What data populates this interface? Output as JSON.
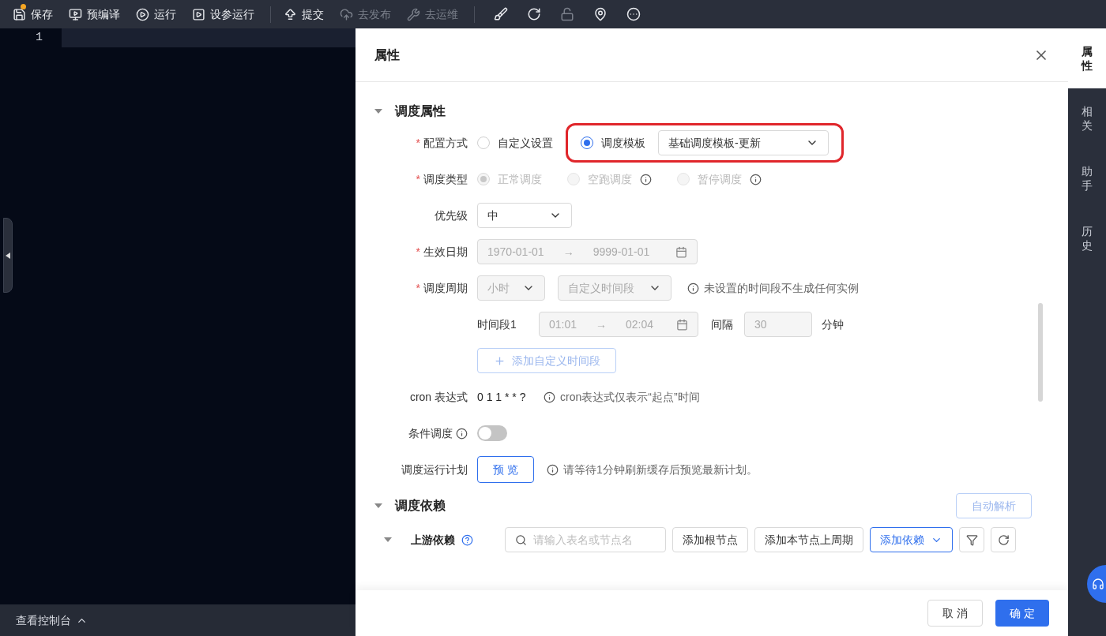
{
  "toolbar": {
    "groups": [
      [
        {
          "label": "保存",
          "disabled": false,
          "modified": true
        },
        {
          "label": "预编译",
          "disabled": false,
          "modified": false
        },
        {
          "label": "运行",
          "disabled": false,
          "modified": false
        },
        {
          "label": "设参运行",
          "disabled": false,
          "modified": false
        }
      ],
      [
        {
          "label": "提交",
          "disabled": false,
          "modified": false
        },
        {
          "label": "去发布",
          "disabled": true,
          "modified": false
        },
        {
          "label": "去运维",
          "disabled": true,
          "modified": false
        }
      ]
    ],
    "icon_buttons": [
      {
        "disabled": false
      },
      {
        "disabled": false
      },
      {
        "disabled": true
      },
      {
        "disabled": false
      },
      {
        "disabled": false
      }
    ]
  },
  "editor": {
    "line_numbers": [
      "1"
    ]
  },
  "console": {
    "label": "查看控制台",
    "expanded": false
  },
  "panel": {
    "title": "属性",
    "schedule": {
      "title": "调度属性",
      "expanded": true,
      "config_mode": {
        "label": "配置方式",
        "required_mark": "*",
        "options": [
          {
            "label": "自定义设置",
            "selected": false
          },
          {
            "label": "调度模板",
            "selected": true
          }
        ],
        "template": "基础调度模板-更新",
        "highlighted": true
      },
      "schedule_type": {
        "label": "调度类型",
        "required_mark": "*",
        "disabled": true,
        "options": [
          {
            "label": "正常调度",
            "selected": true,
            "info": false
          },
          {
            "label": "空跑调度",
            "selected": false,
            "info": true
          },
          {
            "label": "暂停调度",
            "selected": false,
            "info": true
          }
        ]
      },
      "priority": {
        "label": "优先级",
        "value": "中"
      },
      "effective_date": {
        "label": "生效日期",
        "required_mark": "*",
        "start": "1970-01-01",
        "separator": "→",
        "end": "9999-01-01"
      },
      "cycle": {
        "label": "调度周期",
        "required_mark": "*",
        "unit": "小时",
        "mode": "自定义时间段",
        "hint": "未设置的时间段不生成任何实例"
      },
      "periods": [
        {
          "label": "时间段1",
          "start": "01:01",
          "separator": "→",
          "end": "02:04",
          "interval_label": "间隔",
          "interval": "30",
          "unit": "分钟"
        }
      ],
      "add_period": "添加自定义时间段",
      "cron": {
        "label": "cron 表达式",
        "value": "0 1 1 * * ?",
        "hint": "cron表达式仅表示“起点”时间"
      },
      "condition": {
        "label": "条件调度",
        "on": false
      },
      "plan": {
        "label": "调度运行计划",
        "button": "预 览",
        "hint": "请等待1分钟刷新缓存后预览最新计划。"
      }
    },
    "dependencies": {
      "title": "调度依赖",
      "expanded": true,
      "auto_parse": "自动解析",
      "upstream": {
        "label": "上游依赖",
        "expanded": true,
        "search_placeholder": "请输入表名或节点名",
        "buttons": [
          "添加根节点",
          "添加本节点上周期"
        ],
        "add": "添加依赖"
      }
    },
    "cancel": "取 消",
    "confirm": "确 定"
  },
  "side_tabs": [
    {
      "label": "属性",
      "selected": true
    },
    {
      "label": "相关",
      "selected": false
    },
    {
      "label": "助手",
      "selected": false
    },
    {
      "label": "历史",
      "selected": false
    }
  ]
}
